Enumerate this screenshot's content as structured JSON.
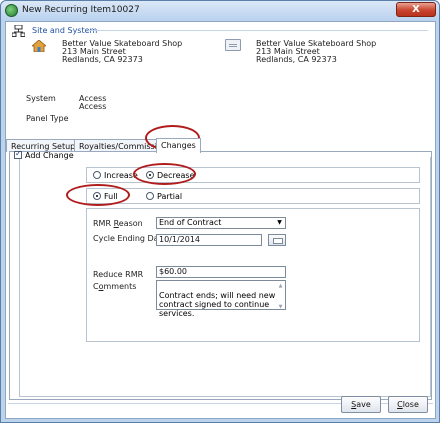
{
  "window": {
    "title": "New Recurring Item10027",
    "close_glyph": "X"
  },
  "site": {
    "section_title": "Site and System",
    "billing": {
      "name": "Better Value Skateboard Shop",
      "street": "213 Main Street",
      "city_state_zip": "Redlands, CA  92373"
    },
    "service": {
      "name": "Better Value Skateboard Shop",
      "street": "213 Main Street",
      "city_state_zip": "Redlands, CA  92373"
    },
    "system_label": "System",
    "system_values": [
      "Access",
      "Access"
    ],
    "panel_type_label": "Panel Type"
  },
  "tabs": [
    {
      "label": "Recurring Setup",
      "active": false
    },
    {
      "label": "Royalties/Commissions",
      "active": false
    },
    {
      "label": "Changes",
      "active": true
    }
  ],
  "changes": {
    "add_change_label": "Add Change",
    "add_change_checked": true,
    "direction": {
      "increase_label": "Increase",
      "decrease_label": "Decrease",
      "selected": "Decrease"
    },
    "scope": {
      "full_label": "Full",
      "partial_label": "Partial",
      "selected": "Full"
    },
    "rmr_reason": {
      "label_pre": "RMR ",
      "label_u": "R",
      "label_post": "eason",
      "value": "End of Contract"
    },
    "cycle_ending_date": {
      "label": "Cycle Ending Date",
      "value": "10/1/2014"
    },
    "reduce_rmr": {
      "label": "Reduce RMR",
      "value": "$60.00"
    },
    "comments": {
      "label_pre": "C",
      "label_u": "o",
      "label_post": "mments",
      "value": "Contract ends; will need new contract signed to continue services."
    }
  },
  "buttons": {
    "save": {
      "u": "S",
      "rest": "ave"
    },
    "close": {
      "u": "C",
      "rest": "lose"
    }
  },
  "colors": {
    "annotation": "#b01c1c",
    "section_title": "#1f4fa0",
    "window_frame": "#bcd3ec"
  },
  "icons": [
    "app-icon",
    "network-icon",
    "house-icon",
    "address-card-icon",
    "calendar-icon"
  ]
}
